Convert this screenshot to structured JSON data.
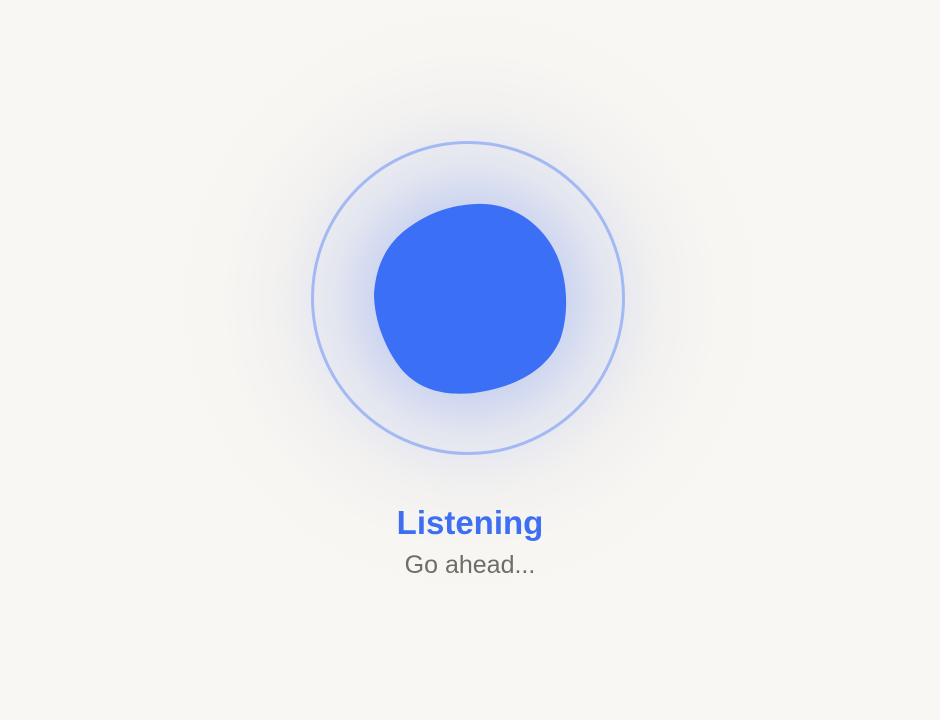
{
  "voice_assistant": {
    "state": "listening",
    "status_title": "Listening",
    "status_subtitle": "Go ahead..."
  },
  "colors": {
    "background": "#f9f7f3",
    "accent": "#3b6ff5",
    "ring": "#8ca8f5",
    "title": "#3e6ff2",
    "subtitle": "#706c66"
  },
  "icons": {
    "orb": "voice-blob-icon"
  }
}
